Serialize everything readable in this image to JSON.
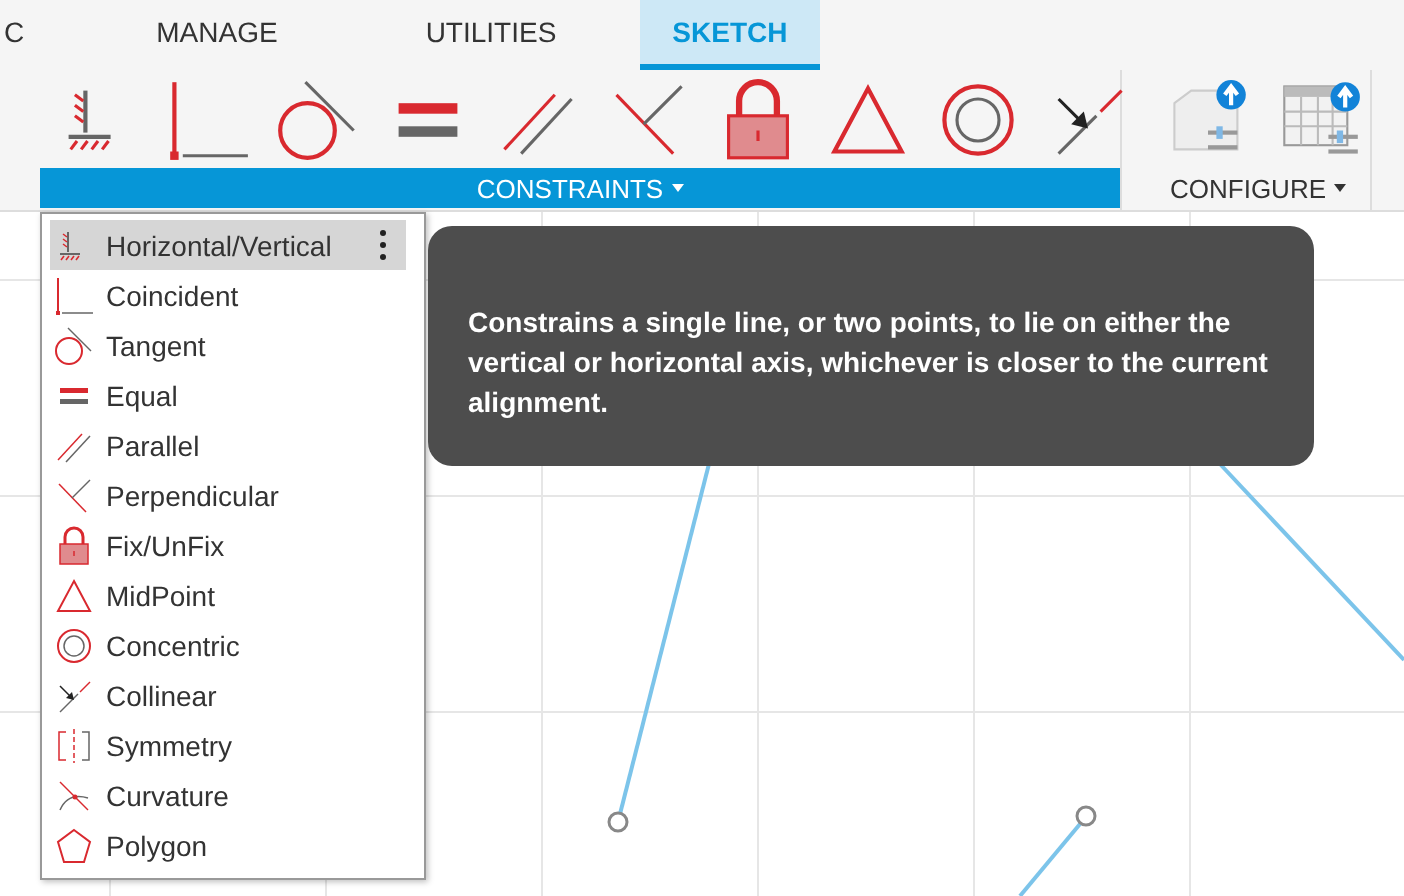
{
  "tabs": [
    {
      "label": "C",
      "selected": false
    },
    {
      "label": "MANAGE",
      "selected": false
    },
    {
      "label": "UTILITIES",
      "selected": false
    },
    {
      "label": "SKETCH",
      "selected": true
    }
  ],
  "constraints_panel": {
    "label": "CONSTRAINTS",
    "tools": [
      {
        "kind": "horizontal"
      },
      {
        "kind": "coincident"
      },
      {
        "kind": "tangent"
      },
      {
        "kind": "equal"
      },
      {
        "kind": "parallel"
      },
      {
        "kind": "perpendicular"
      },
      {
        "kind": "fix"
      },
      {
        "kind": "midpoint"
      },
      {
        "kind": "concentric"
      },
      {
        "kind": "collinear"
      }
    ]
  },
  "configure_panel": {
    "label": "CONFIGURE",
    "tools": [
      {
        "kind": "box"
      },
      {
        "kind": "table"
      }
    ]
  },
  "menu": {
    "items": [
      {
        "label": "Horizontal/Vertical",
        "kind": "horizontal",
        "selected": true
      },
      {
        "label": "Coincident",
        "kind": "coincident",
        "selected": false
      },
      {
        "label": "Tangent",
        "kind": "tangent",
        "selected": false
      },
      {
        "label": "Equal",
        "kind": "equal",
        "selected": false
      },
      {
        "label": "Parallel",
        "kind": "parallel",
        "selected": false
      },
      {
        "label": "Perpendicular",
        "kind": "perpendicular",
        "selected": false
      },
      {
        "label": "Fix/UnFix",
        "kind": "fix",
        "selected": false
      },
      {
        "label": "MidPoint",
        "kind": "midpoint",
        "selected": false
      },
      {
        "label": "Concentric",
        "kind": "concentric",
        "selected": false
      },
      {
        "label": "Collinear",
        "kind": "collinear",
        "selected": false
      },
      {
        "label": "Symmetry",
        "kind": "symmetry",
        "selected": false
      },
      {
        "label": "Curvature",
        "kind": "curvature",
        "selected": false
      },
      {
        "label": "Polygon",
        "kind": "polygon",
        "selected": false
      }
    ]
  },
  "tooltip": {
    "text": "Constrains a single line, or two points, to lie on either the vertical or horizontal axis, whichever is closer to the current alignment."
  }
}
